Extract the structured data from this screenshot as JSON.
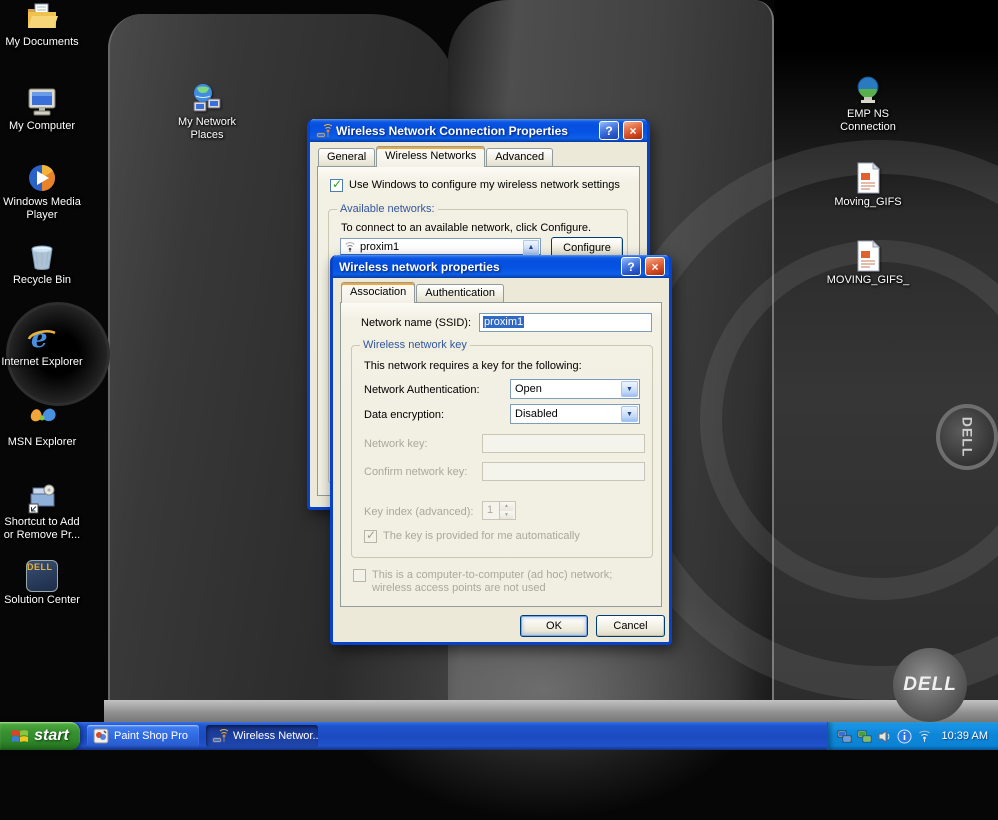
{
  "window_controls": {
    "help": "?",
    "close": "×"
  },
  "glyphs": {
    "dropdown": "▼",
    "scroll_up": "▲",
    "spin_up": "▲",
    "spin_down": "▼",
    "check": "✓"
  },
  "desktop": {
    "icons": [
      {
        "label": "My Documents"
      },
      {
        "label": "My Computer"
      },
      {
        "label": "My Network Places"
      },
      {
        "label": "Windows Media Player"
      },
      {
        "label": "Recycle Bin"
      },
      {
        "label": "Internet Explorer"
      },
      {
        "label": "MSN Explorer"
      },
      {
        "label": "Shortcut to Add or Remove Pr..."
      },
      {
        "label": "Solution Center"
      },
      {
        "label": "EMP NS Connection"
      },
      {
        "label": "Moving_GIFS"
      },
      {
        "label": "MOVING_GIFS_"
      }
    ],
    "solution_center_icon_text": "DELL",
    "dell_badge_text": "DELL",
    "dell_logo_text": "DELL"
  },
  "connection_dialog": {
    "title": "Wireless Network Connection Properties",
    "tabs": [
      "General",
      "Wireless Networks",
      "Advanced"
    ],
    "use_windows_checkbox_label": "Use Windows to configure my wireless network settings",
    "available_networks": {
      "caption": "Available networks:",
      "instruction": "To connect to an available network, click Configure.",
      "items": [
        "proxim1"
      ],
      "configure_button": "Configure"
    }
  },
  "properties_dialog": {
    "title": "Wireless network properties",
    "tabs": [
      "Association",
      "Authentication"
    ],
    "network_name_label": "Network name (SSID):",
    "network_name_value": "proxim1",
    "key_group": {
      "caption": "Wireless network key",
      "instruction": "This network requires a key for the following:",
      "network_authentication_label": "Network Authentication:",
      "network_authentication_value": "Open",
      "data_encryption_label": "Data encryption:",
      "data_encryption_value": "Disabled",
      "network_key_label": "Network key:",
      "confirm_network_key_label": "Confirm network key:",
      "key_index_label": "Key index (advanced):",
      "key_index_value": "1",
      "auto_key_checkbox_label": "The key is provided for me automatically"
    },
    "adhoc_checkbox_label": "This is a computer-to-computer (ad hoc) network; wireless access points are not used",
    "ok_button": "OK",
    "cancel_button": "Cancel"
  },
  "taskbar": {
    "start_button": "start",
    "tasks": [
      "Paint Shop Pro",
      "Wireless Networ..."
    ],
    "clock": "10:39 AM"
  }
}
